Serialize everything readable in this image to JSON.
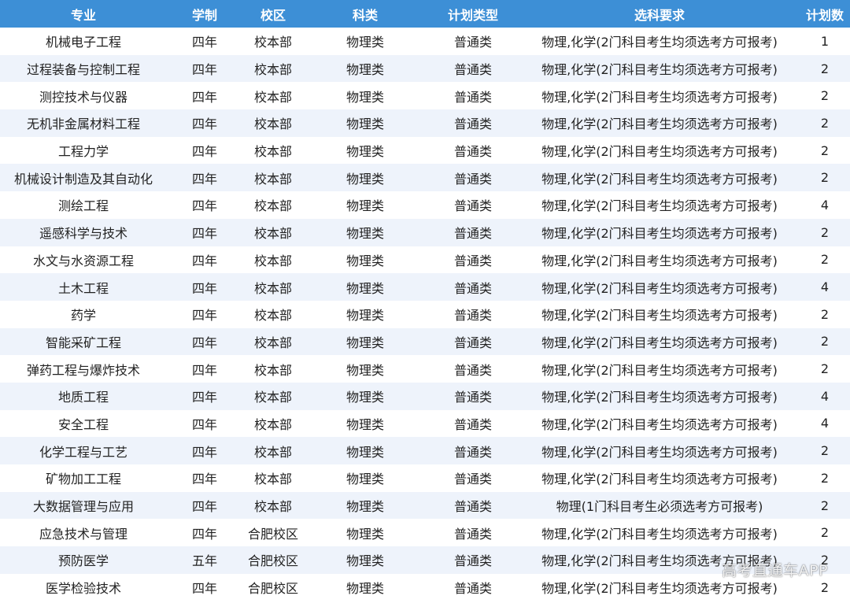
{
  "headers": [
    "专业",
    "学制",
    "校区",
    "科类",
    "计划类型",
    "选科要求",
    "计划数"
  ],
  "rows": [
    [
      "机械电子工程",
      "四年",
      "校本部",
      "物理类",
      "普通类",
      "物理,化学(2门科目考生均须选考方可报考)",
      "1"
    ],
    [
      "过程装备与控制工程",
      "四年",
      "校本部",
      "物理类",
      "普通类",
      "物理,化学(2门科目考生均须选考方可报考)",
      "2"
    ],
    [
      "测控技术与仪器",
      "四年",
      "校本部",
      "物理类",
      "普通类",
      "物理,化学(2门科目考生均须选考方可报考)",
      "2"
    ],
    [
      "无机非金属材料工程",
      "四年",
      "校本部",
      "物理类",
      "普通类",
      "物理,化学(2门科目考生均须选考方可报考)",
      "2"
    ],
    [
      "工程力学",
      "四年",
      "校本部",
      "物理类",
      "普通类",
      "物理,化学(2门科目考生均须选考方可报考)",
      "2"
    ],
    [
      "机械设计制造及其自动化",
      "四年",
      "校本部",
      "物理类",
      "普通类",
      "物理,化学(2门科目考生均须选考方可报考)",
      "2"
    ],
    [
      "测绘工程",
      "四年",
      "校本部",
      "物理类",
      "普通类",
      "物理,化学(2门科目考生均须选考方可报考)",
      "4"
    ],
    [
      "遥感科学与技术",
      "四年",
      "校本部",
      "物理类",
      "普通类",
      "物理,化学(2门科目考生均须选考方可报考)",
      "2"
    ],
    [
      "水文与水资源工程",
      "四年",
      "校本部",
      "物理类",
      "普通类",
      "物理,化学(2门科目考生均须选考方可报考)",
      "2"
    ],
    [
      "土木工程",
      "四年",
      "校本部",
      "物理类",
      "普通类",
      "物理,化学(2门科目考生均须选考方可报考)",
      "4"
    ],
    [
      "药学",
      "四年",
      "校本部",
      "物理类",
      "普通类",
      "物理,化学(2门科目考生均须选考方可报考)",
      "2"
    ],
    [
      "智能采矿工程",
      "四年",
      "校本部",
      "物理类",
      "普通类",
      "物理,化学(2门科目考生均须选考方可报考)",
      "2"
    ],
    [
      "弹药工程与爆炸技术",
      "四年",
      "校本部",
      "物理类",
      "普通类",
      "物理,化学(2门科目考生均须选考方可报考)",
      "2"
    ],
    [
      "地质工程",
      "四年",
      "校本部",
      "物理类",
      "普通类",
      "物理,化学(2门科目考生均须选考方可报考)",
      "4"
    ],
    [
      "安全工程",
      "四年",
      "校本部",
      "物理类",
      "普通类",
      "物理,化学(2门科目考生均须选考方可报考)",
      "4"
    ],
    [
      "化学工程与工艺",
      "四年",
      "校本部",
      "物理类",
      "普通类",
      "物理,化学(2门科目考生均须选考方可报考)",
      "2"
    ],
    [
      "矿物加工工程",
      "四年",
      "校本部",
      "物理类",
      "普通类",
      "物理,化学(2门科目考生均须选考方可报考)",
      "2"
    ],
    [
      "大数据管理与应用",
      "四年",
      "校本部",
      "物理类",
      "普通类",
      "物理(1门科目考生必须选考方可报考)",
      "2"
    ],
    [
      "应急技术与管理",
      "四年",
      "合肥校区",
      "物理类",
      "普通类",
      "物理,化学(2门科目考生均须选考方可报考)",
      "2"
    ],
    [
      "预防医学",
      "五年",
      "合肥校区",
      "物理类",
      "普通类",
      "物理,化学(2门科目考生均须选考方可报考)",
      "2"
    ],
    [
      "医学检验技术",
      "四年",
      "合肥校区",
      "物理类",
      "普通类",
      "物理,化学(2门科目考生均须选考方可报考)",
      "2"
    ]
  ],
  "watermark": "高考直通车APP"
}
